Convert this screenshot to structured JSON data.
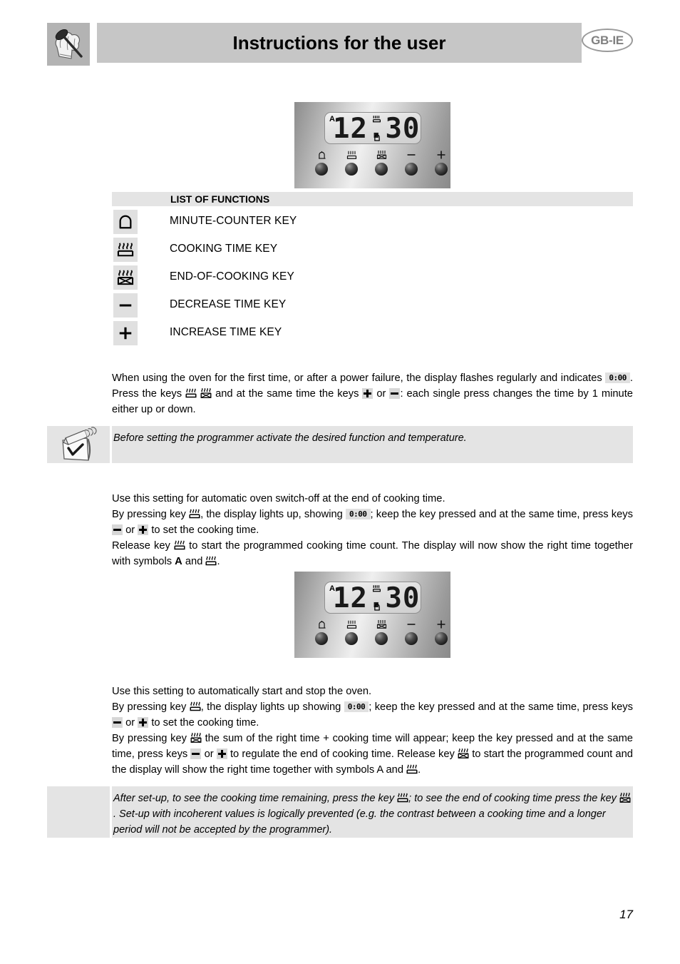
{
  "header": {
    "title": "Instructions for the user",
    "language_badge": "GB-IE",
    "logo_icon": "chef-hat-spoon-logo"
  },
  "programmer_panel": {
    "lcd": {
      "indicator_a": "A",
      "time": "12.30",
      "symbol_top": "cooking-time-icon",
      "symbol_bottom": "minute-counter-icon"
    },
    "keys": [
      {
        "icon": "minute-counter-icon",
        "name": "minute-counter-key"
      },
      {
        "icon": "cooking-time-icon",
        "name": "cooking-time-key"
      },
      {
        "icon": "end-of-cooking-icon",
        "name": "end-of-cooking-key"
      },
      {
        "icon": "minus-icon",
        "name": "decrease-time-key"
      },
      {
        "icon": "plus-icon",
        "name": "increase-time-key"
      }
    ]
  },
  "list_of_functions": {
    "heading": "LIST OF FUNCTIONS",
    "items": [
      {
        "icon": "minute-counter-icon",
        "label": "MINUTE-COUNTER KEY"
      },
      {
        "icon": "cooking-time-icon",
        "label": "COOKING TIME KEY"
      },
      {
        "icon": "end-of-cooking-icon",
        "label": "END-OF-COOKING KEY"
      },
      {
        "icon": "minus-icon",
        "label": "DECREASE TIME KEY"
      },
      {
        "icon": "plus-icon",
        "label": "INCREASE TIME KEY"
      }
    ]
  },
  "paragraph_first_use": {
    "part1": "When using the oven for the first time, or after a power failure, the display flashes regularly and indicates",
    "chip1": "0:00",
    "part2": ". Press the keys",
    "part3": "and at the same time the keys",
    "part4": "or",
    "part5": ": each single press changes the time by 1 minute either up or down."
  },
  "note_before_setting": {
    "icon": "notepad-pencil-check-icon",
    "text": "Before setting the programmer activate the desired function and temperature."
  },
  "paragraph_auto_switch_off": {
    "line1": "Use this setting for automatic oven switch-off at the end of cooking time.",
    "line2a": "By pressing key",
    "line2b": ", the display lights up, showing",
    "chip": "0:00",
    "line2c": "; keep the key pressed and at the same time, press keys",
    "line2d": "or",
    "line2e": "to set the cooking time.",
    "line3a": "Release key",
    "line3b": "to start the programmed cooking time count. The display will now show the right time together with symbols",
    "symbol_a": "A",
    "line3c": "and",
    "line3d": "."
  },
  "paragraph_auto_start_stop": {
    "line1": "Use this setting to automatically start and stop the oven.",
    "line2a": "By pressing key",
    "line2b": ", the display lights up showing",
    "chip": "0:00",
    "line2c": "; keep the key pressed and at the same time, press keys",
    "line2d": "or",
    "line2e": "to set the cooking time.",
    "line3a": "By pressing key",
    "line3b": "the sum of the right time + cooking time will appear; keep the key pressed and at the same time, press keys",
    "line3c": "or",
    "line3d": "to regulate the end of cooking time. Release key",
    "line3e": "to start the programmed count and the display will show the right time together with symbols A and",
    "line3f": "."
  },
  "note_after_setup": {
    "part1": "After set-up, to see the cooking time remaining, press the key",
    "part2": "; to see the end of cooking time press the key",
    "part3": ". Set-up with incoherent values is logically prevented (e.g. the contrast between a cooking time and a longer period will not be accepted by the programmer)."
  },
  "page_number": "17"
}
